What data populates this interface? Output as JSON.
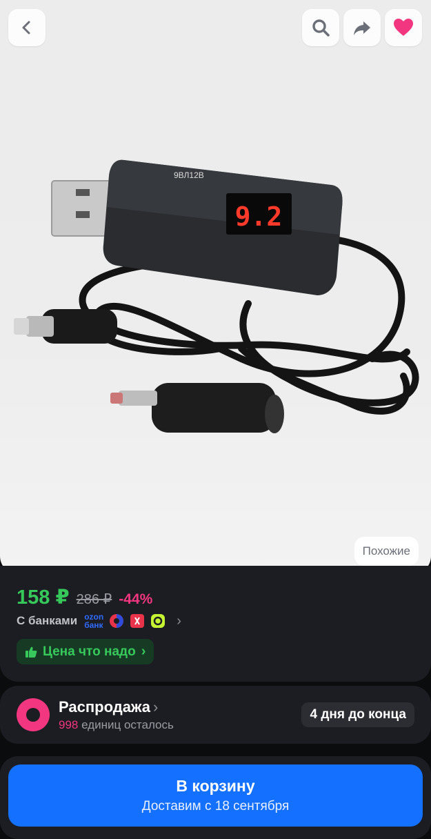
{
  "header": {
    "back_icon": "chevron-left-icon",
    "search_icon": "search-icon",
    "share_icon": "share-arrow-icon",
    "favorite_icon": "heart-icon",
    "favorite_color": "#f2367f"
  },
  "gallery": {
    "similar_label": "Похожие",
    "display_reading": "9.2",
    "device_label": "9ВЛ12В"
  },
  "price": {
    "current": "158 ₽",
    "old": "286 ₽",
    "discount": "-44%",
    "banks_label": "С банками",
    "ozon_line1": "ozon",
    "ozon_line2": "банк",
    "good_price_label": "Цена что надо"
  },
  "sale": {
    "title": "Распродажа",
    "count": "998",
    "count_suffix": " единиц осталось",
    "days_left": "4 дня до конца"
  },
  "cart": {
    "button_label": "В корзину",
    "delivery": "Доставим с 18 сентября"
  },
  "colors": {
    "price_green": "#36c85a",
    "discount_pink": "#f2367f",
    "cart_blue": "#1470ff",
    "panel_dark": "#1c1d22"
  }
}
